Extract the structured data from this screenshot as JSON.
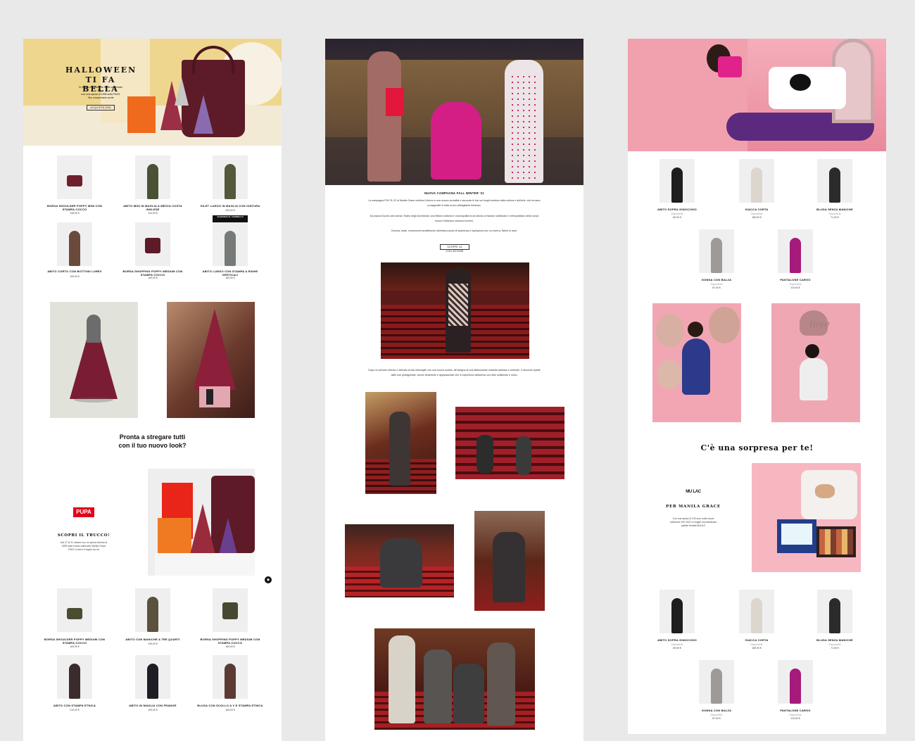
{
  "colors": {
    "page_bg": "#e9e9e9",
    "hero_yellow": "#efd68f",
    "burgundy": "#6e1f2e",
    "pupa_red": "#e1001a",
    "pink_bg": "#f3a9b7"
  },
  "left": {
    "hero": {
      "title_line1": "HALLOWEEN",
      "title_line2": "TI FA BELLA",
      "text_line1": "In regalo un cofanetto make-up firmato",
      "text_line2": "Pupa",
      "text_line3": "con una spesa di 159€ sulla FW21",
      "text_line4": "*fino a esaurimento scorte",
      "cta": "ACQUISTA ORA"
    },
    "grid1": [
      {
        "title": "BORSA SHOULDER POPPY MINI CON STAMPA COCCO",
        "price": "135,90 €",
        "tag": ""
      },
      {
        "title": "ABITO MIDI IN MAGLIA A MEZZA COSTA INGLESE",
        "price": "144,90 €",
        "tag": ""
      },
      {
        "title": "GILET LUNGO IN MAGLIA CON CINTURA",
        "price": "229,00 €",
        "tag": ""
      },
      {
        "title": "ABITO CORTO CON BOTTONI LUREX",
        "price": "199,00 €",
        "tag": ""
      },
      {
        "title": "BORSA SHOPPING POPPY MEDIUM CON STAMPA COCCO",
        "price": "169,90 €",
        "tag": ""
      },
      {
        "title": "ABITO LUNGO CON STAMPA A RIGHE VERTICALI",
        "price": "189,90 €",
        "tag": "AGGIUNGI AL CARRELLO"
      }
    ],
    "headline_line1": "Pronta a stregare tutti",
    "headline_line2": "con il tuo nuovo look?",
    "pupa_logo": "PUPA",
    "pupa_title": "SCOPRI IL TRUCCO!",
    "pupa_text_line1": "Dal 27 al 31 ottobre con un spesa minima di",
    "pupa_text_line2": "159€ sulla nuova collezione Manila Grace",
    "pupa_text_line3": "FW21 in dono il regalo tra noi",
    "grid2": [
      {
        "title": "BORSA SHOULDER POPPY MEDIUM CON STAMPA COCCO",
        "price": "169,90 €"
      },
      {
        "title": "ABITO CON MANICHE A TRE QUARTI",
        "price": "199,00 €"
      },
      {
        "title": "BORSA SHOPPING POPPY MEDIUM CON STAMPA COCCO",
        "price": "169,90 €"
      },
      {
        "title": "ABITO CON STAMPA ETNICA",
        "price": "219,00 €"
      },
      {
        "title": "ABITO IN MAGLIA CON FRANGE",
        "price": "199,00 €"
      },
      {
        "title": "BLUSA CON SCOLLO A V E STAMPA ETNICA",
        "price": "169,00 €"
      }
    ]
  },
  "middle": {
    "title": "NUOVA CAMPAGNA FALL WINTER '21",
    "p1_line1": "La campagna F/W 21-22 di Manila Grace celebra il ritorno a una nuova normalità e racconta le luci sui luoghi simbolo della cultura e dell'arte, che tornano",
    "p1_line2": "protagonisti in tutta la loro abbagliante bellezza.",
    "p2_line1": "Da piazza Duomo allo storico Teatro degli Arcimboldi, una Milano notturna e cosmopolita fa da sfondo al fascino sofisticato e metropolitano della nuova",
    "p2_line2": "nuova Collezione autunno inverno.",
    "p3": "Cinema, teatri, monumenti architettonici diventano punto di ripartenza e ispirazione per un inverno Talent in town.",
    "cta": "SCOPRI LA COLLEZIONE",
    "p4_line1": "Dopo un periodo intenso e delicato la vita ridisceglie con una nuova routine, all'insegna di una affascinante rinascita artistica e culturale. Il racconto riparte",
    "p4_line2": "dalle sue protagoniste, donne dinamiche e appassionate che si esprimono attraverso uno stile sofisticato e unico."
  },
  "right": {
    "grid1": [
      {
        "title": "ABITO SOPRA GINOCCHIO",
        "old": "Disponibile",
        "price": "89,90 €"
      },
      {
        "title": "GIACCA CORTA",
        "old": "Disponibile",
        "price": "185,90 €"
      },
      {
        "title": "BLUSA SENZA MANICHE",
        "old": "Disponibile",
        "price": "71,90 €"
      },
      {
        "title": "GONNA CON BALZA",
        "old": "Disponibile",
        "price": "87,90 €"
      },
      {
        "title": "PANTALONE CARGO",
        "old": "Disponibile",
        "price": "119,90 €"
      }
    ],
    "surprise": "C'è una sorpresa per te!",
    "mulac_logo": "MU LAC",
    "mulac_title": "PER MANILA GRACE",
    "mulac_text_line1": "Con una spesa di 125 euro sulla nuova",
    "mulac_text_line2": "collezione WO 2021 in regalo una fantastica",
    "mulac_text_line3": "palette firmata MULAC",
    "grid2": [
      {
        "title": "ABITO SOPRA GINOCCHIO",
        "old": "Disponibile",
        "price": "89,90 €"
      },
      {
        "title": "GIACCA CORTA",
        "old": "Disponibile",
        "price": "185,90 €"
      },
      {
        "title": "BLUSA SENZA MANICHE",
        "old": "Disponibile",
        "price": "71,90 €"
      },
      {
        "title": "GONNA CON BALZA",
        "old": "Disponibile",
        "price": "87,90 €"
      },
      {
        "title": "PANTALONE CARGO",
        "old": "Disponibile",
        "price": "119,90 €"
      }
    ]
  }
}
